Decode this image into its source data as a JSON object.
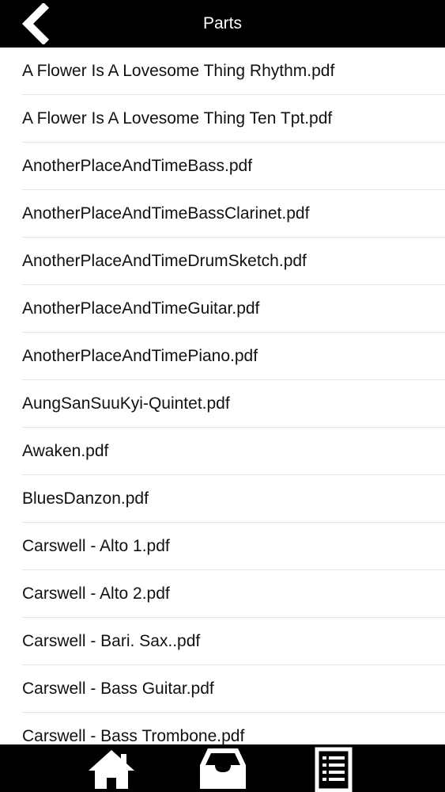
{
  "header": {
    "title": "Parts",
    "back_icon": "chevron-left-icon"
  },
  "files": [
    "A Flower Is A Lovesome Thing Rhythm.pdf",
    "A Flower Is A Lovesome Thing Ten Tpt.pdf",
    "AnotherPlaceAndTimeBass.pdf",
    "AnotherPlaceAndTimeBassClarinet.pdf",
    "AnotherPlaceAndTimeDrumSketch.pdf",
    "AnotherPlaceAndTimeGuitar.pdf",
    "AnotherPlaceAndTimePiano.pdf",
    "AungSanSuuKyi-Quintet.pdf",
    "Awaken.pdf",
    "BluesDanzon.pdf",
    "Carswell - Alto 1.pdf",
    "Carswell - Alto 2.pdf",
    "Carswell - Bari. Sax..pdf",
    "Carswell - Bass Guitar.pdf",
    "Carswell - Bass Trombone.pdf"
  ],
  "tab_bar": {
    "tabs": [
      {
        "icon": "home-icon"
      },
      {
        "icon": "inbox-tray-icon"
      },
      {
        "icon": "list-document-icon"
      }
    ]
  },
  "colors": {
    "bar_background": "#000000",
    "bar_foreground": "#ffffff",
    "row_text": "#111111",
    "row_divider": "#e3e3e3"
  }
}
